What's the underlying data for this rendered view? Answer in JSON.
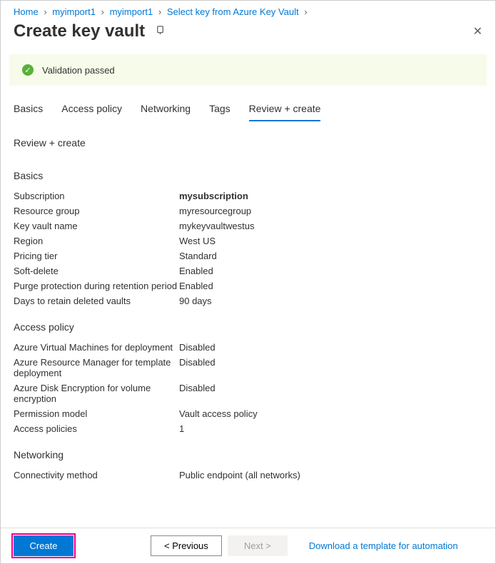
{
  "breadcrumb": {
    "items": [
      {
        "label": "Home"
      },
      {
        "label": "myimport1"
      },
      {
        "label": "myimport1"
      },
      {
        "label": "Select key from Azure Key Vault"
      }
    ]
  },
  "header": {
    "title": "Create key vault"
  },
  "validation": {
    "message": "Validation passed"
  },
  "tabs": {
    "items": [
      {
        "label": "Basics"
      },
      {
        "label": "Access policy"
      },
      {
        "label": "Networking"
      },
      {
        "label": "Tags"
      },
      {
        "label": "Review + create"
      }
    ]
  },
  "page_subtitle": "Review + create",
  "basics": {
    "heading": "Basics",
    "subscription_label": "Subscription",
    "subscription_value": "mysubscription",
    "rg_label": "Resource group",
    "rg_value": "myresourcegroup",
    "kvname_label": "Key vault name",
    "kvname_value": "mykeyvaultwestus",
    "region_label": "Region",
    "region_value": "West US",
    "pricing_label": "Pricing tier",
    "pricing_value": "Standard",
    "softdel_label": "Soft-delete",
    "softdel_value": "Enabled",
    "purge_label": "Purge protection during retention period",
    "purge_value": "Enabled",
    "retain_label": "Days to retain deleted vaults",
    "retain_value": "90 days"
  },
  "access": {
    "heading": "Access policy",
    "vm_label": "Azure Virtual Machines for deployment",
    "vm_value": "Disabled",
    "arm_label": "Azure Resource Manager for template deployment",
    "arm_value": "Disabled",
    "disk_label": "Azure Disk Encryption for volume encryption",
    "disk_value": "Disabled",
    "perm_label": "Permission model",
    "perm_value": "Vault access policy",
    "policies_label": "Access policies",
    "policies_value": "1"
  },
  "networking": {
    "heading": "Networking",
    "conn_label": "Connectivity method",
    "conn_value": "Public endpoint (all networks)"
  },
  "footer": {
    "create": "Create",
    "previous": "< Previous",
    "next": "Next >",
    "download": "Download a template for automation"
  }
}
